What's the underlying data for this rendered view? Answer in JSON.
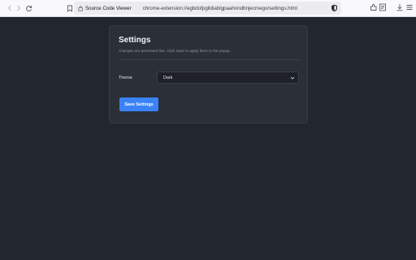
{
  "browser": {
    "site_name": "Source Code Viewer",
    "url": "chrome-extension://egbdofpglldiablgpaahnndbnjecmego/settings.html"
  },
  "settings": {
    "title": "Settings",
    "subtitle": "Changes are previewed live. Click Save to apply them to the popup.",
    "theme_label": "Theme",
    "theme_value": "Dark",
    "save_label": "Save Settings"
  },
  "colors": {
    "background": "#22262e",
    "card": "#2b2f37",
    "accent": "#3b82f6"
  },
  "icons": {
    "back": "back-arrow-icon",
    "forward": "forward-arrow-icon",
    "reload": "reload-icon",
    "bookmark": "bookmark-icon",
    "extension": "extension-icon",
    "shield": "tracking-protection-icon",
    "extensions": "extensions-icon",
    "reader": "reader-view-icon",
    "downloads": "downloads-icon",
    "menu": "menu-icon"
  }
}
